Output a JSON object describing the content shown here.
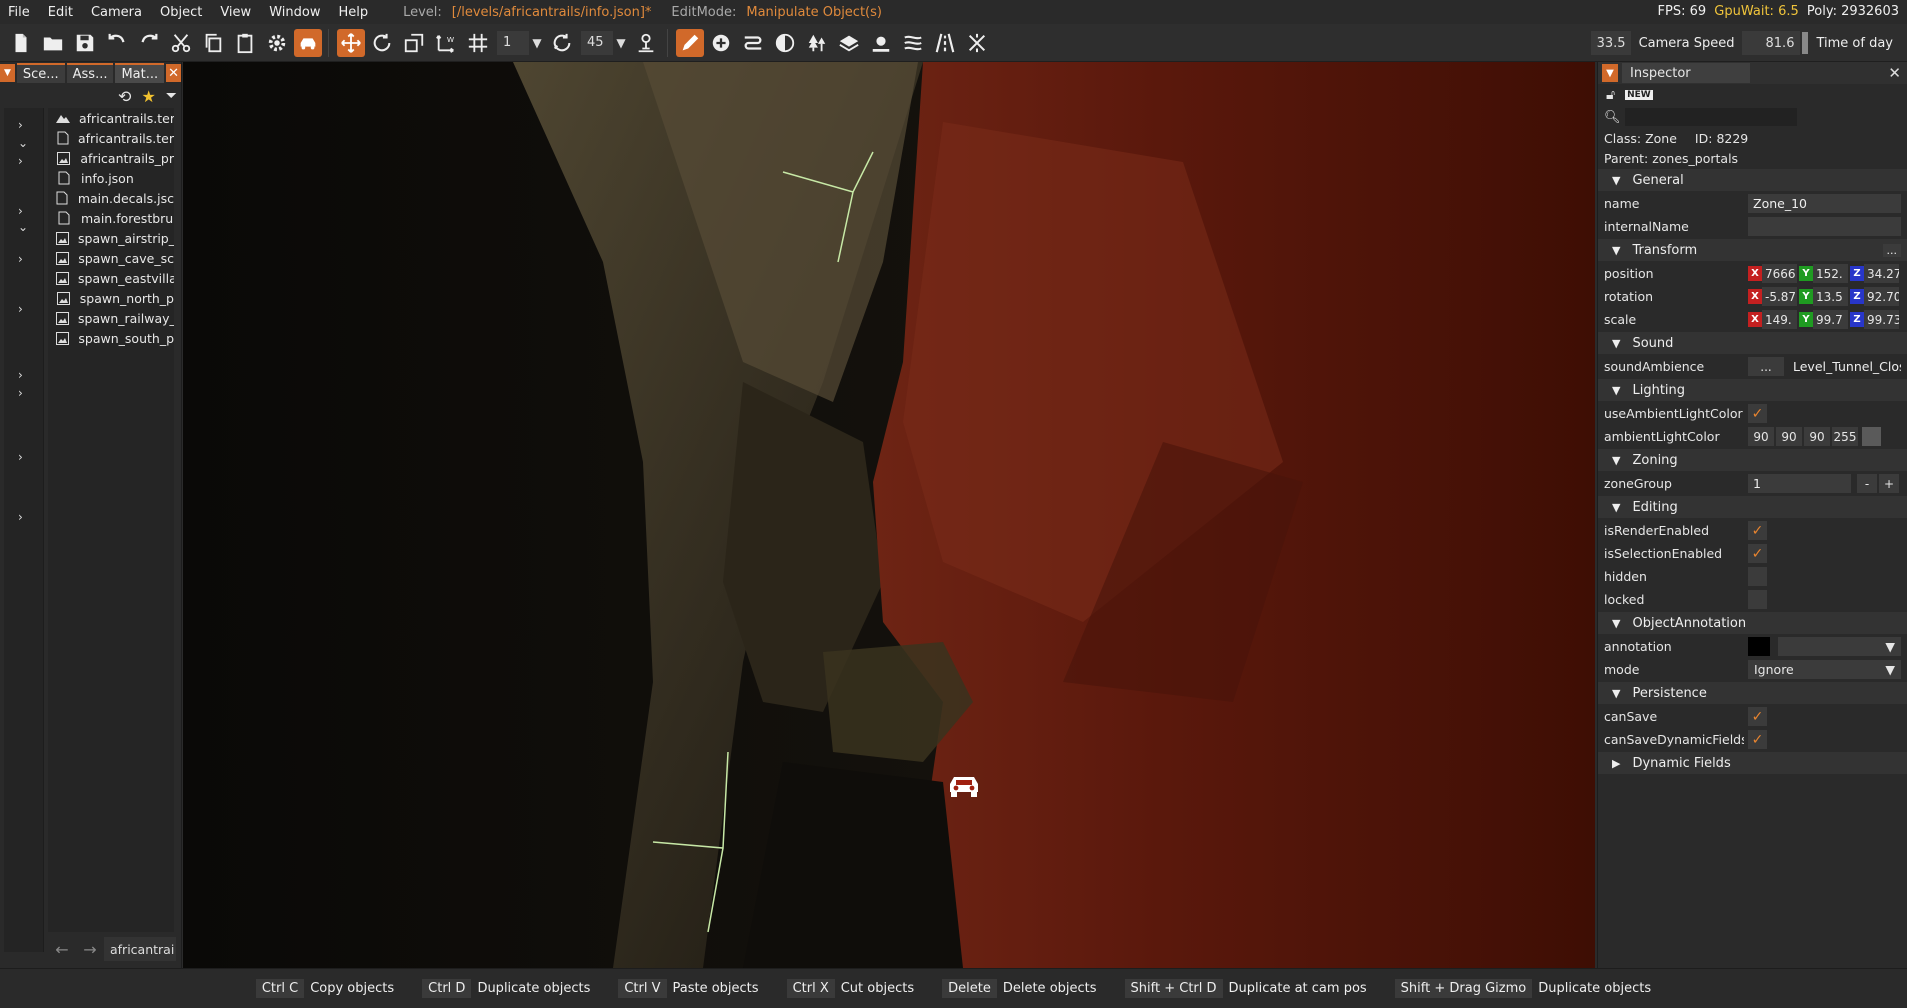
{
  "menu": {
    "items": [
      "File",
      "Edit",
      "Camera",
      "Object",
      "View",
      "Window",
      "Help"
    ],
    "level_label": "Level:",
    "level_value": "[/levels/africantrails/info.json]*",
    "editmode_label": "EditMode:",
    "editmode_value": "Manipulate Object(s)",
    "fps": "FPS: 69",
    "gpuwait": "GpuWait: 6.5",
    "poly": "Poly: 2932603"
  },
  "toolbar": {
    "snap_value": "1",
    "angle_value": "45",
    "camera_value_field": "33.5",
    "camera_speed_label": "Camera Speed",
    "camera_speed_value": "81.6",
    "time_of_day_label": "Time of day"
  },
  "left_panel": {
    "tabs": [
      "Sce...",
      "Ass...",
      "Mat..."
    ],
    "files": [
      {
        "name": "africantrails.ter",
        "icon": "terrain-icon"
      },
      {
        "name": "africantrails.ter",
        "icon": "file-icon"
      },
      {
        "name": "africantrails_pr",
        "icon": "image-icon"
      },
      {
        "name": "info.json",
        "icon": "file-icon"
      },
      {
        "name": "main.decals.jsc",
        "icon": "file-icon"
      },
      {
        "name": "main.forestbru",
        "icon": "file-icon"
      },
      {
        "name": "spawn_airstrip_",
        "icon": "image-icon"
      },
      {
        "name": "spawn_cave_sc",
        "icon": "image-icon"
      },
      {
        "name": "spawn_eastvilla",
        "icon": "image-icon"
      },
      {
        "name": "spawn_north_p",
        "icon": "image-icon"
      },
      {
        "name": "spawn_railway_",
        "icon": "image-icon"
      },
      {
        "name": "spawn_south_p",
        "icon": "image-icon"
      }
    ],
    "path": "africantrai"
  },
  "inspector": {
    "title": "Inspector",
    "class_label": "Class:",
    "class_value": "Zone",
    "id_label": "ID:",
    "id_value": "8229",
    "parent_label": "Parent:",
    "parent_value": "zones_portals",
    "sections": {
      "general": "General",
      "transform": "Transform",
      "sound": "Sound",
      "lighting": "Lighting",
      "zoning": "Zoning",
      "editing": "Editing",
      "object_annotation": "ObjectAnnotation",
      "persistence": "Persistence",
      "dynamic_fields": "Dynamic Fields"
    },
    "props": {
      "name_label": "name",
      "name_value": "Zone_10",
      "internal_name_label": "internalName",
      "internal_name_value": "",
      "transform_more": "...",
      "position_label": "position",
      "position": [
        "7666",
        "152.",
        "34.27"
      ],
      "rotation_label": "rotation",
      "rotation": [
        "-5.87",
        "13.5",
        "92.70"
      ],
      "scale_label": "scale",
      "scale": [
        "149.",
        "99.7",
        "99.73"
      ],
      "sound_ambience_label": "soundAmbience",
      "sound_ambience_button": "...",
      "sound_ambience_value": "Level_Tunnel_Clos",
      "use_ambient_label": "useAmbientLightColor",
      "ambient_color_label": "ambientLightColor",
      "ambient_color": [
        "90",
        "90",
        "90",
        "255"
      ],
      "zone_group_label": "zoneGroup",
      "zone_group_value": "1",
      "zone_minus": "-",
      "zone_plus": "+",
      "is_render_label": "isRenderEnabled",
      "is_selection_label": "isSelectionEnabled",
      "hidden_label": "hidden",
      "locked_label": "locked",
      "annotation_label": "annotation",
      "mode_label": "mode",
      "mode_value": "Ignore",
      "can_save_label": "canSave",
      "can_save_dynamic_label": "canSaveDynamicFields"
    }
  },
  "statusbar": [
    {
      "key": "Ctrl C",
      "desc": "Copy objects"
    },
    {
      "key": "Ctrl D",
      "desc": "Duplicate objects"
    },
    {
      "key": "Ctrl V",
      "desc": "Paste objects"
    },
    {
      "key": "Ctrl X",
      "desc": "Cut objects"
    },
    {
      "key": "Delete",
      "desc": "Delete objects"
    },
    {
      "key": "Shift + Ctrl D",
      "desc": "Duplicate at cam pos"
    },
    {
      "key": "Shift + Drag Gizmo",
      "desc": "Duplicate objects"
    }
  ],
  "colors": {
    "accent": "#d1692a",
    "zone_tint": "#5a1208",
    "check": "#e8842f"
  }
}
